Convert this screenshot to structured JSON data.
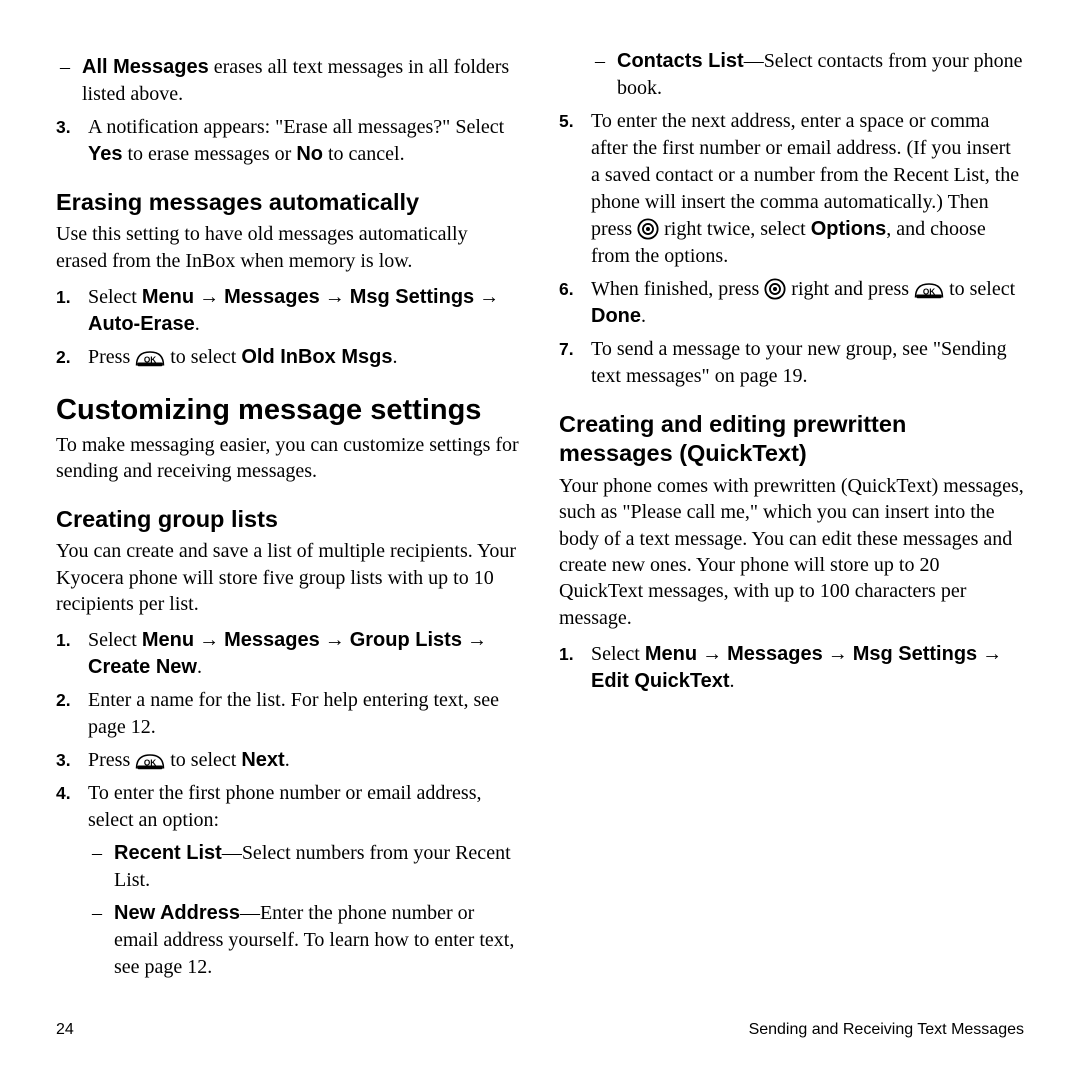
{
  "footer": {
    "page": "24",
    "title": "Sending and Receiving Text Messages"
  },
  "arrow": "→",
  "left": {
    "topDash": {
      "bold": "All Messages",
      "rest": " erases all text messages in all folders listed above."
    },
    "topStep3": {
      "a": "A notification appears: \"Erase all messages?\" Select ",
      "yes": "Yes",
      "b": " to erase messages or ",
      "no": "No",
      "c": " to cancel."
    },
    "h2a": "Erasing messages automatically",
    "pA": "Use this setting to have old messages automatically erased from the InBox when memory is low.",
    "erase": {
      "s1": {
        "pre": "Select ",
        "m": "Menu",
        "msgs": "Messages",
        "set": "Msg Settings",
        "ae": "Auto-Erase",
        "dot": "."
      },
      "s2": {
        "pre": "Press ",
        "mid": " to select ",
        "old": "Old InBox Msgs",
        "dot": "."
      }
    },
    "h1": "Customizing message settings",
    "pB": "To make messaging easier, you can customize settings for sending and receiving messages.",
    "h2b": "Creating group lists",
    "pC": "You can create and save a list of multiple recipients. Your Kyocera phone will store five group lists with up to 10 recipients per list.",
    "group": {
      "s1": {
        "pre": "Select ",
        "m": "Menu",
        "msgs": "Messages",
        "gl": "Group Lists",
        "cn": "Create New",
        "dot": "."
      },
      "s2": "Enter a name for the list. For help entering text, see page 12.",
      "s3": {
        "pre": "Press ",
        "mid": " to select ",
        "next": "Next",
        "dot": "."
      },
      "s4": "To enter the first phone number or email address, select an option:",
      "d1": {
        "bold": "Recent List",
        "rest": "—Select numbers from your Recent List."
      }
    }
  },
  "right": {
    "d2": {
      "bold": "New Address",
      "rest": "—Enter the phone number or email address yourself. To learn how to enter text, see page 12."
    },
    "d3": {
      "bold": "Contacts List",
      "rest": "—Select contacts from your phone book."
    },
    "s5": {
      "a": "To enter the next address, enter a space or comma after the first number or email address. (If you insert a saved contact or a number from the Recent List, the phone will insert the comma automatically.) Then press ",
      "b": " right twice, select ",
      "opt": "Options",
      "c": ", and choose from the options."
    },
    "s6": {
      "a": "When finished, press ",
      "b": " right and press ",
      "c": " to select ",
      "done": "Done",
      "dot": "."
    },
    "s7": "To send a message to your new group, see \"Sending text messages\" on page 19.",
    "h2": "Creating and editing prewritten messages (QuickText)",
    "p": "Your phone comes with prewritten (QuickText) messages, such as \"Please call me,\" which you can insert into the body of a text message. You can edit these messages and create new ones. Your phone will store up to 20 QuickText messages, with up to 100 characters per message.",
    "qt": {
      "pre": "Select ",
      "m": "Menu",
      "msgs": "Messages",
      "set": "Msg Settings",
      "eq": "Edit QuickText",
      "dot": "."
    }
  }
}
